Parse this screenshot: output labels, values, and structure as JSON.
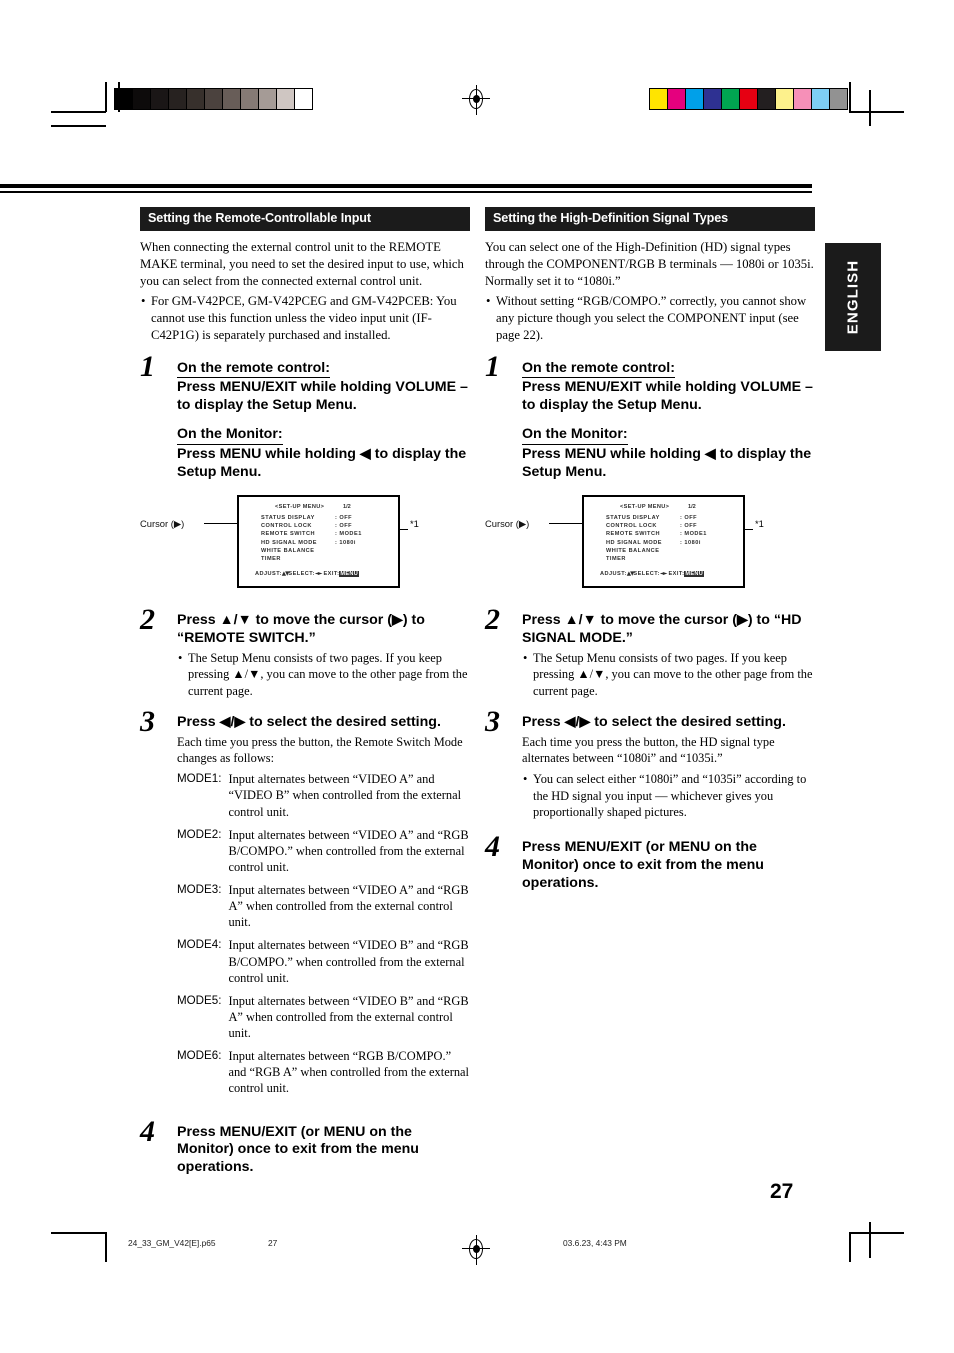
{
  "page": {
    "number": "27",
    "language_tab": "ENGLISH"
  },
  "color_bar": {
    "gray_swatches": [
      "#000000",
      "#0d0b0b",
      "#1a1616",
      "#272220",
      "#37302c",
      "#4b423e",
      "#685d58",
      "#857a75",
      "#a59b96",
      "#cfc6c2",
      "#ffffff"
    ],
    "color_swatches": [
      "#ffe400",
      "#e5007e",
      "#00a0e9",
      "#2e3192",
      "#00a551",
      "#e60012",
      "#231f20",
      "#fdf18c",
      "#f690b8",
      "#7ecef4",
      "#929292"
    ]
  },
  "left_column": {
    "section_title": "Setting the Remote-Controllable Input",
    "intro": "When connecting the external control unit to the REMOTE MAKE terminal, you need to set the desired input to use, which you can select from the connected external control unit.",
    "intro_bullets": [
      "For GM-V42PCE, GM-V42PCEG and GM-V42PCEB: You cannot use this function unless the video input unit (IF-C42P1G) is separately purchased and installed."
    ],
    "steps": [
      {
        "num": "1",
        "title_a": "On the remote control:",
        "body_a": "Press MENU/EXIT while holding VOLUME – to display the Setup Menu.",
        "title_b": "On the Monitor:",
        "body_b": "Press MENU while holding ◀ to display the Setup Menu."
      },
      {
        "num": "2",
        "title": "Press ▲/▼ to move the cursor (▶) to “REMOTE SWITCH.”",
        "bullets": [
          "The Setup Menu consists of two pages. If you keep pressing ▲/▼, you can move to the other page from the current page."
        ]
      },
      {
        "num": "3",
        "title": "Press ◀/▶ to select the desired setting.",
        "body": "Each time you press the button, the Remote Switch Mode changes as follows:"
      },
      {
        "num": "4",
        "title": "Press MENU/EXIT (or MENU on the Monitor) once to exit from the menu operations."
      }
    ],
    "mode_table": [
      {
        "label": "MODE1:",
        "text": "Input alternates between “VIDEO A” and “VIDEO B” when controlled from the external control unit."
      },
      {
        "label": "MODE2:",
        "text": "Input alternates between “VIDEO A” and “RGB B/COMPO.” when controlled from the external control unit."
      },
      {
        "label": "MODE3:",
        "text": "Input alternates between “VIDEO A” and “RGB A” when controlled from the external control unit."
      },
      {
        "label": "MODE4:",
        "text": "Input alternates between “VIDEO B” and “RGB B/COMPO.” when controlled from the external control unit."
      },
      {
        "label": "MODE5:",
        "text": "Input alternates between “VIDEO B” and “RGB A” when controlled from the external control unit."
      },
      {
        "label": "MODE6:",
        "text": "Input alternates between “RGB B/COMPO.” and “RGB A” when controlled from the external control unit."
      }
    ]
  },
  "right_column": {
    "section_title": "Setting the High-Definition Signal Types",
    "intro": "You can select one of the High-Definition (HD) signal types through the COMPONENT/RGB B terminals — 1080i or 1035i. Normally set it to “1080i.”",
    "intro_bullets": [
      "Without setting “RGB/COMPO.” correctly, you cannot show any picture though you select the COMPONENT input (see page 22)."
    ],
    "steps": [
      {
        "num": "1",
        "title_a": "On the remote control:",
        "body_a": "Press MENU/EXIT while holding VOLUME – to display the Setup Menu.",
        "title_b": "On the Monitor:",
        "body_b": "Press MENU while holding ◀ to display the Setup Menu."
      },
      {
        "num": "2",
        "title": "Press ▲/▼ to move the cursor (▶) to “HD SIGNAL MODE.”",
        "bullets": [
          "The Setup Menu consists of two pages. If you keep pressing ▲/▼, you can move to the other page from the current page."
        ]
      },
      {
        "num": "3",
        "title": "Press ◀/▶ to select the desired setting.",
        "body": "Each time you press the button, the HD signal type alternates between “1080i” and “1035i.”",
        "bullets": [
          "You can select either “1080i” and “1035i” according to the HD signal you input — whichever gives you proportionally shaped pictures."
        ]
      },
      {
        "num": "4",
        "title": "Press MENU/EXIT (or MENU on the Monitor) once to exit from the menu operations."
      }
    ]
  },
  "osd_figure": {
    "cursor_label": "Cursor (▶)",
    "callout": "*1",
    "title": "<SET-UP MENU>",
    "page_indicator": "1/2",
    "items": [
      "STATUS DISPLAY",
      "CONTROL LOCK",
      "REMOTE SWITCH",
      "HD SIGNAL MODE",
      "WHITE BALANCE",
      "TIMER"
    ],
    "values": [
      ": OFF",
      ": OFF",
      ": MODE1",
      ": 1080i",
      "",
      ""
    ],
    "footer_adjust": "ADJUST:",
    "footer_select": "SELECT:",
    "footer_exit": "EXIT:",
    "footer_exit_key": "MENU"
  },
  "footer": {
    "file": "24_33_GM_V42[E].p65",
    "page": "27",
    "date": "03.6.23, 4:43 PM"
  }
}
